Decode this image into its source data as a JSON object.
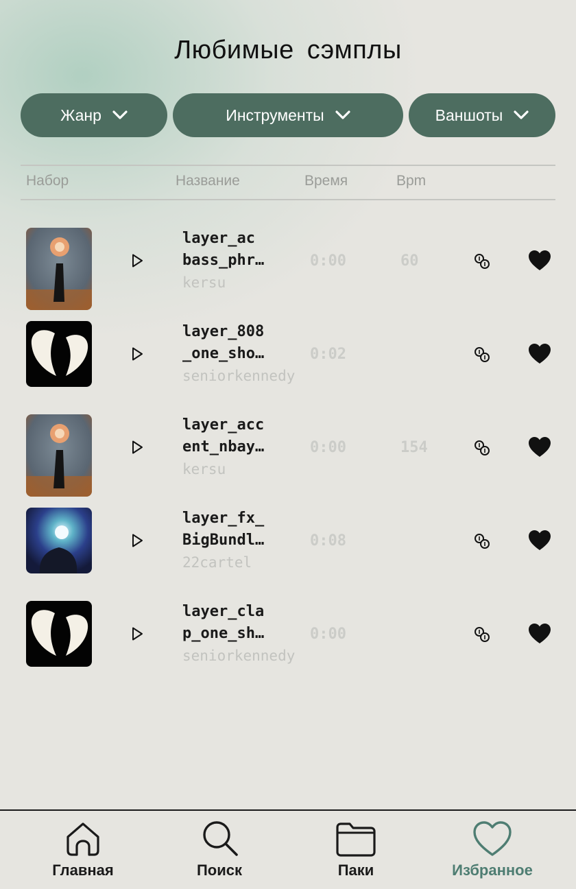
{
  "header": {
    "title": "Любимые  сэмплы"
  },
  "filters": [
    {
      "label": "Жанр"
    },
    {
      "label": "Инструменты"
    },
    {
      "label": "Ваншоты"
    }
  ],
  "columns": {
    "pack": "Набор",
    "name": "Название",
    "time": "Время",
    "bpm": "Bpm"
  },
  "samples": [
    {
      "name_line1": "layer_ac",
      "name_line2": "bass_phr…",
      "author": "kersu",
      "time": "0:00",
      "bpm": "60",
      "cover": "flower-head-figure",
      "liked": true
    },
    {
      "name_line1": "layer_808",
      "name_line2": "_one_sho…",
      "author": "seniorkennedy",
      "time": "0:02",
      "bpm": "",
      "cover": "white-wings",
      "liked": true
    },
    {
      "name_line1": "layer_acc",
      "name_line2": "ent_nbay…",
      "author": "kersu",
      "time": "0:00",
      "bpm": "154",
      "cover": "flower-head-figure",
      "liked": true
    },
    {
      "name_line1": "layer_fx_",
      "name_line2": "BigBundl…",
      "author": "22cartel",
      "time": "0:08",
      "bpm": "",
      "cover": "blue-glow-figure",
      "liked": true
    },
    {
      "name_line1": "layer_cla",
      "name_line2": "p_one_sh…",
      "author": "seniorkennedy",
      "time": "0:00",
      "bpm": "",
      "cover": "white-wings",
      "liked": true
    }
  ],
  "nav": [
    {
      "label": "Главная",
      "icon": "home-icon"
    },
    {
      "label": "Поиск",
      "icon": "search-icon"
    },
    {
      "label": "Паки",
      "icon": "folder-icon"
    },
    {
      "label": "Избранное",
      "icon": "heart-icon",
      "active": true
    }
  ],
  "colors": {
    "accent": "#4d6d60",
    "nav_active": "#4e7d72",
    "background": "#e6e5e0"
  }
}
